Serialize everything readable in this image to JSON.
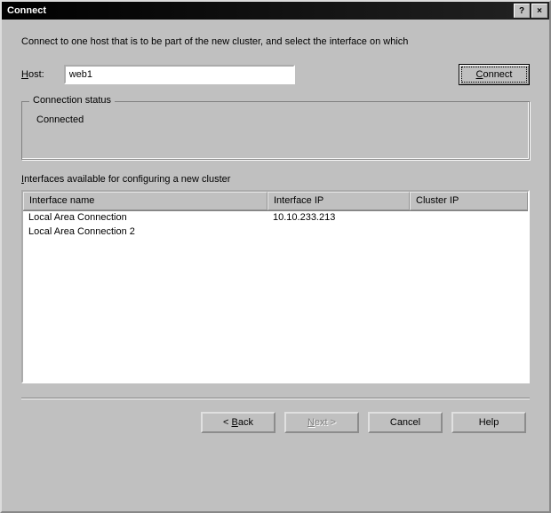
{
  "window": {
    "title": "Connect",
    "help_btn": "?",
    "close_btn": "×"
  },
  "instruction": "Connect to one host that is to be part of the new cluster, and select the interface on which",
  "host": {
    "label_pre": "H",
    "label_post": "ost:",
    "value": "web1",
    "connect_label_pre": "C",
    "connect_label_post": "onnect"
  },
  "status": {
    "legend": "Connection status",
    "text": "Connected"
  },
  "interfaces": {
    "label_pre": "I",
    "label_post": "nterfaces available for configuring a new cluster",
    "columns": {
      "name": "Interface name",
      "ip": "Interface IP",
      "cluster": "Cluster IP"
    },
    "rows": [
      {
        "name": "Local Area Connection",
        "ip": "10.10.233.213",
        "cluster": ""
      },
      {
        "name": "Local Area Connection 2",
        "ip": "",
        "cluster": ""
      }
    ]
  },
  "buttons": {
    "back_pre": "< ",
    "back_u": "B",
    "back_post": "ack",
    "next_pre": "",
    "next_u": "N",
    "next_post": "ext >",
    "cancel": "Cancel",
    "help": "Help"
  }
}
